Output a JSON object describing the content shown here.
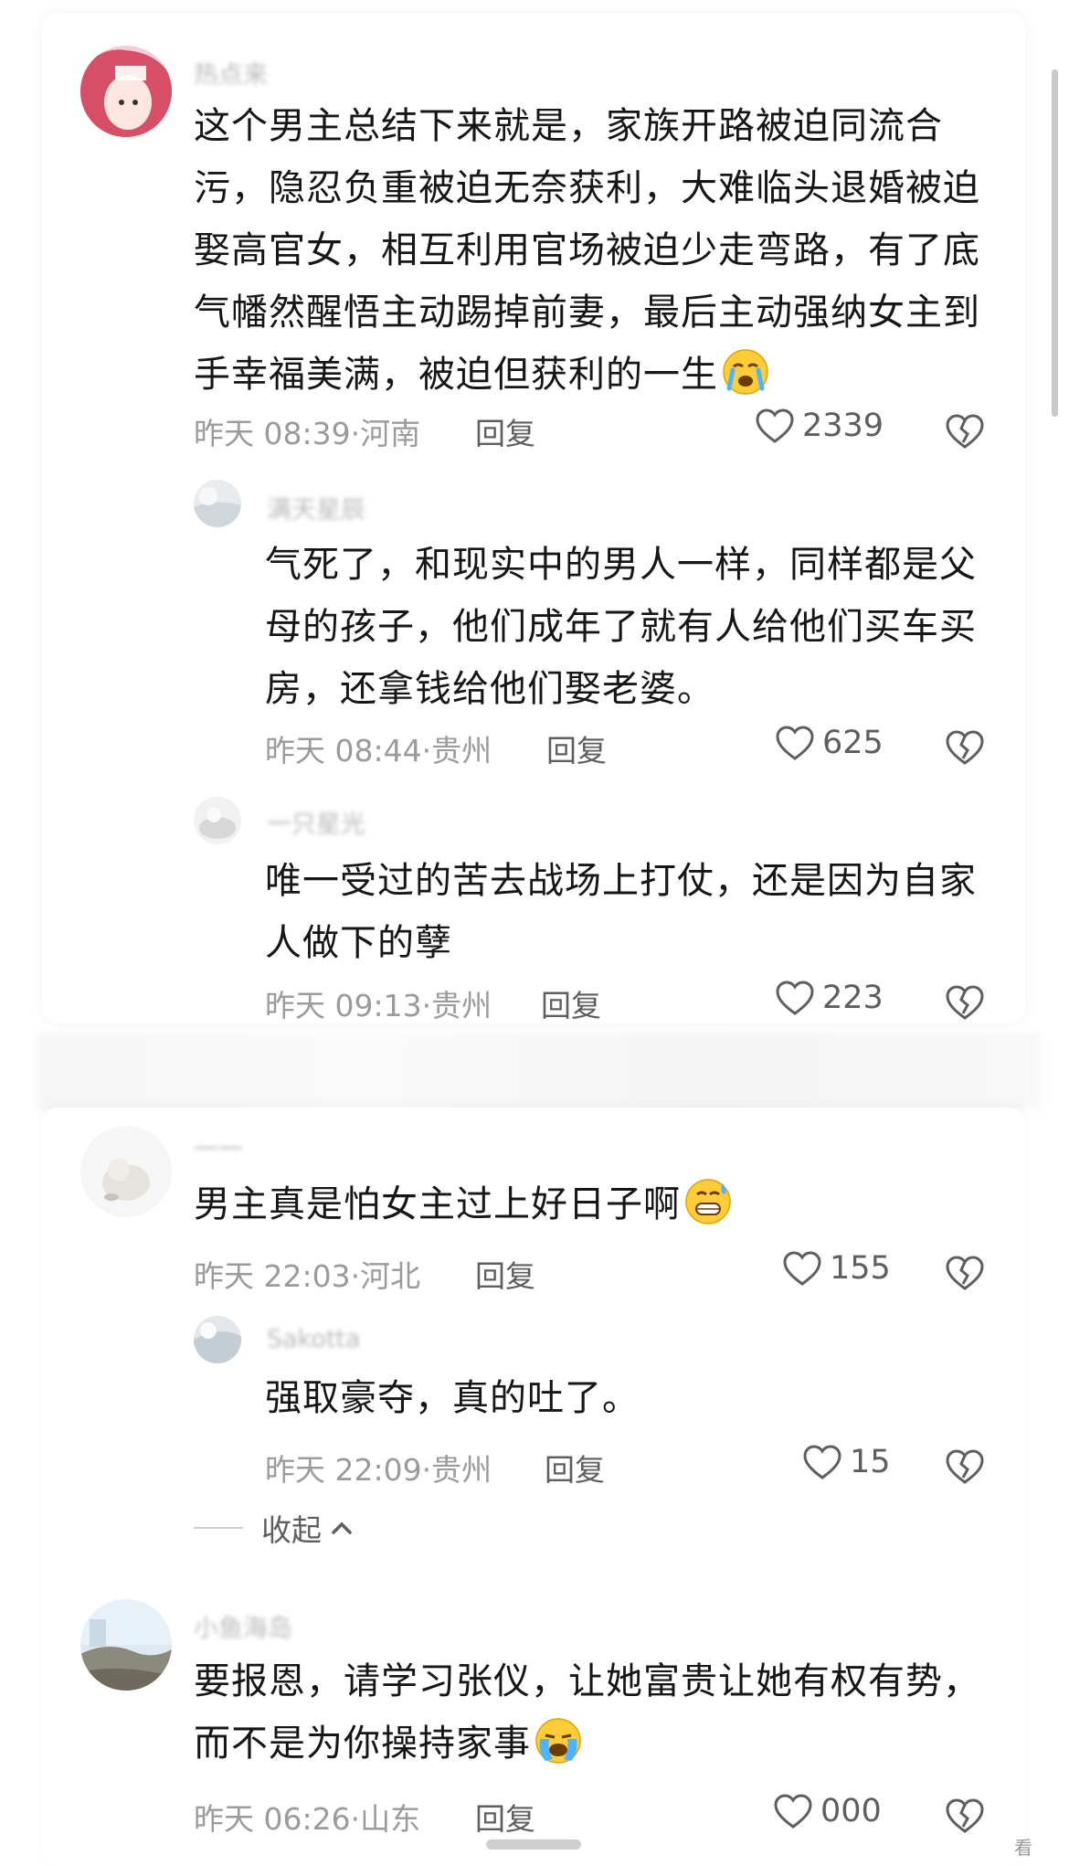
{
  "comments": [
    {
      "username": "热点来",
      "text": "这个男主总结下来就是，家族开路被迫同流合\n污，隐忍负重被迫无奈获利，大难临头退婚被迫\n娶高官女，相互利用官场被迫少走弯路，有了底\n气幡然醒悟主动踢掉前妻，最后主动强纳女主到\n手幸福美满，被迫但获利的一生",
      "emoji": "crying-face-emoji",
      "time_location": "昨天 08:39·河南",
      "reply_label": "回复",
      "likes": "2339"
    },
    {
      "username": "满天星辰",
      "text": "气死了，和现实中的男人一样，同样都是父\n母的孩子，他们成年了就有人给他们买车买\n房，还拿钱给他们娶老婆。",
      "time_location": "昨天 08:44·贵州",
      "reply_label": "回复",
      "likes": "625"
    },
    {
      "username": "一只星光",
      "text": "唯一受过的苦去战场上打仗，还是因为自家\n人做下的孽",
      "time_location": "昨天 09:13·贵州",
      "reply_label": "回复",
      "likes": "223"
    },
    {
      "username": "一一",
      "text": "男主真是怕女主过上好日子啊",
      "emoji": "grimacing-sweat-emoji",
      "time_location": "昨天 22:03·河北",
      "reply_label": "回复",
      "likes": "155"
    },
    {
      "username": "Sakotta",
      "text": "强取豪夺，真的吐了。",
      "time_location": "昨天 22:09·贵州",
      "reply_label": "回复",
      "likes": "15"
    },
    {
      "username": "小鱼海岛",
      "text": "要报恩，请学习张仪，让她富贵让她有权有势，\n而不是为你操持家事",
      "emoji": "loudly-crying-emoji",
      "time_location": "昨天 06:26·山东",
      "reply_label": "回复",
      "likes": "000"
    }
  ],
  "collapse_label": "收起",
  "corner_text": "看",
  "colors": {
    "meta_gray": "#9b9b9b",
    "text_dark": "#161616",
    "icon_gray": "#5e5e5e"
  }
}
